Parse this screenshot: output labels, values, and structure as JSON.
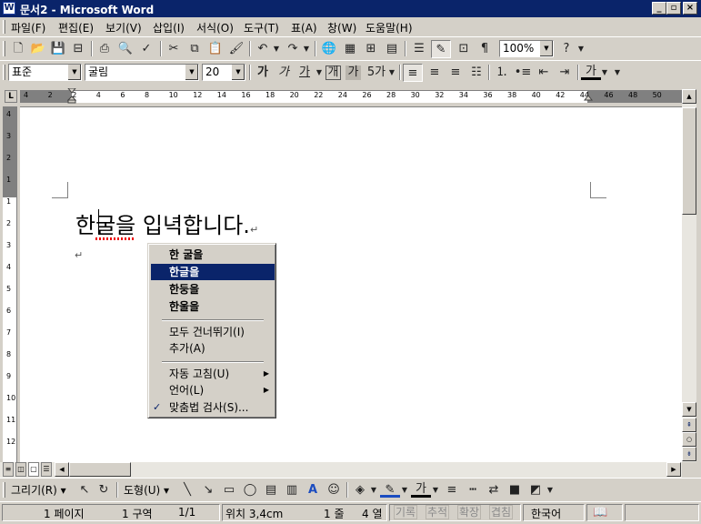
{
  "window": {
    "title": "문서2 - Microsoft Word",
    "icon": "word-doc-icon",
    "controls": [
      "minimize",
      "restore",
      "close"
    ]
  },
  "menubar": {
    "items": [
      "파일(F)",
      "편집(E)",
      "보기(V)",
      "삽입(I)",
      "서식(O)",
      "도구(T)",
      "표(A)",
      "창(W)",
      "도움말(H)"
    ]
  },
  "standard_toolbar": {
    "icons": [
      "new-document",
      "open",
      "save",
      "permission",
      "print",
      "print-preview",
      "spelling-grammar",
      "cut",
      "copy",
      "paste",
      "format-painter",
      "undo",
      "redo",
      "hyperlink",
      "tables-borders",
      "insert-table",
      "insert-excel",
      "columns",
      "drawing",
      "document-map",
      "show-hide"
    ],
    "zoom": "100%",
    "help": "help-icon"
  },
  "formatting_toolbar": {
    "style": "표준",
    "font": "굴림",
    "size": "20",
    "bold": "가",
    "italic": "가",
    "underline": "가",
    "char_border": "개",
    "char_shading": "가",
    "phonetic": "5가",
    "font_color": "가",
    "alignment_icons": [
      "align-left",
      "align-center",
      "align-right",
      "distribute"
    ],
    "list_icons": [
      "numbering",
      "bullets",
      "decrease-indent",
      "increase-indent"
    ]
  },
  "ruler": {
    "marks": [
      "4",
      "2",
      "2",
      "4",
      "6",
      "8",
      "10",
      "12",
      "14",
      "16",
      "18",
      "20",
      "22",
      "24",
      "26",
      "28",
      "30",
      "32",
      "34",
      "36",
      "38",
      "40",
      "42",
      "44",
      "46",
      "48",
      "50"
    ],
    "vertical_marks": [
      "4",
      "3",
      "2",
      "1",
      "1",
      "2",
      "3",
      "4",
      "5",
      "6",
      "7",
      "8",
      "9",
      "10",
      "11",
      "12"
    ]
  },
  "document": {
    "text_before_cursor": "한",
    "text_misspelled": "굴을",
    "text_rest": " 입녁합니다.",
    "paragraph_mark": "↵",
    "empty_line_mark": "↵"
  },
  "context_menu": {
    "suggestions": [
      "한 굴을",
      "한글을",
      "한둥을",
      "한울을"
    ],
    "selected_index": 1,
    "actions": [
      {
        "label": "모두 건너뛰기(I)"
      },
      {
        "label": "추가(A)"
      }
    ],
    "submenus": [
      {
        "label": "자동 고침(U)"
      },
      {
        "label": "언어(L)"
      }
    ],
    "spelling": {
      "label": "맞춤법 검사(S)...",
      "icon": "spelling-check-icon"
    }
  },
  "drawing_toolbar": {
    "draw": "그리기(R)",
    "shapes": "도형(U)",
    "font_color_label": "가",
    "icons": [
      "select-objects",
      "free-rotate",
      "line",
      "arrow",
      "rectangle",
      "oval",
      "text-box",
      "vertical-text-box",
      "wordart",
      "clip-art",
      "fill-color",
      "line-color",
      "font-color",
      "line-style",
      "dash-style",
      "arrow-style",
      "shadow",
      "3d"
    ]
  },
  "status_bar": {
    "page": "1 페이지",
    "section": "1 구역",
    "page_of": "1/1",
    "position": "위치 3,4cm",
    "line": "1 줄",
    "column": "4 열",
    "rec": "기록",
    "trk": "추적",
    "ext": "확장",
    "ovr": "겹침",
    "language": "한국어"
  }
}
